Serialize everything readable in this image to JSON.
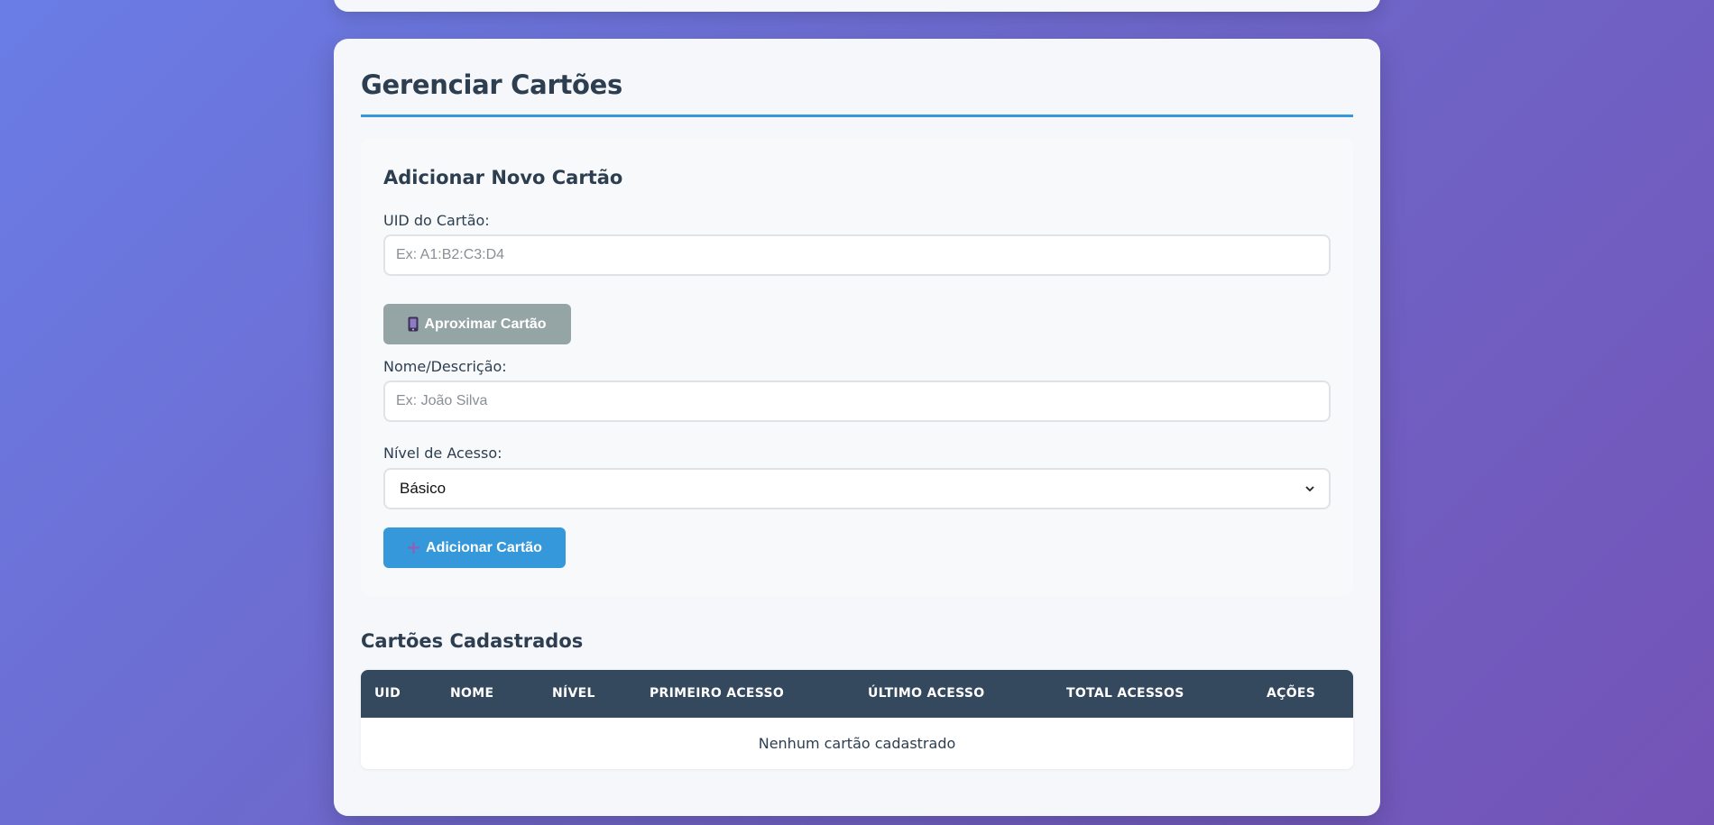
{
  "page": {
    "title": "Gerenciar Cartões"
  },
  "form": {
    "title": "Adicionar Novo Cartão",
    "uid_label": "UID do Cartão:",
    "uid_placeholder": "Ex: A1:B2:C3:D4",
    "uid_value": "",
    "scan_button_label": "Aproximar Cartão",
    "name_label": "Nome/Descrição:",
    "name_placeholder": "Ex: João Silva",
    "name_value": "",
    "level_label": "Nível de Acesso:",
    "level_selected": "Básico",
    "add_button_label": "Adicionar Cartão"
  },
  "table": {
    "title": "Cartões Cadastrados",
    "columns": [
      "UID",
      "NOME",
      "NÍVEL",
      "PRIMEIRO ACESSO",
      "ÚLTIMO ACESSO",
      "TOTAL ACESSOS",
      "AÇÕES"
    ],
    "empty_message": "Nenhum cartão cadastrado"
  },
  "icons": {
    "scan_button_icon": "mobile-phone-icon",
    "add_button_icon": "plus-icon",
    "select_icon": "chevron-down-icon"
  },
  "colors": {
    "accent": "#3498db",
    "header_bg": "#34495e",
    "secondary_button": "#95a5a6",
    "plus_icon": "#9b59b6"
  }
}
